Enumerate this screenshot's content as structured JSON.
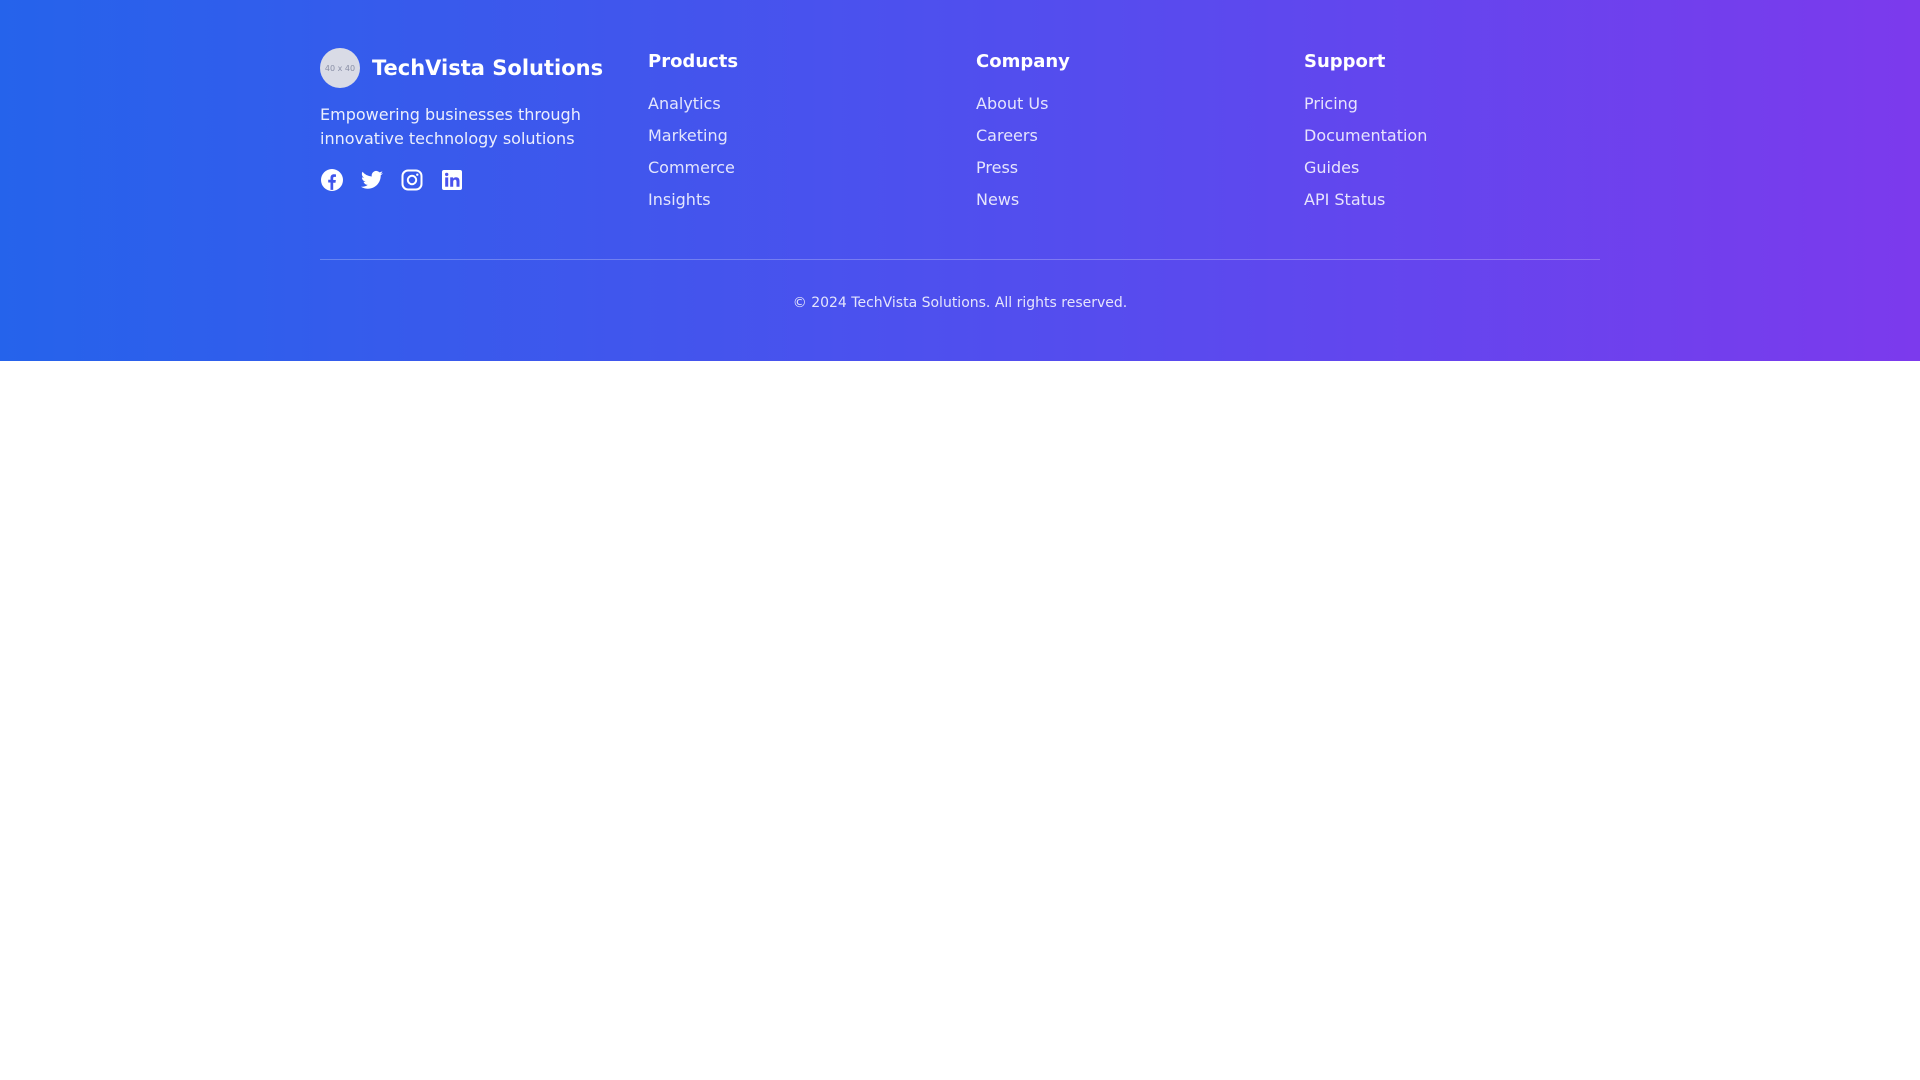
{
  "brand": {
    "logo_placeholder": "40 x 40",
    "name": "TechVista Solutions",
    "tagline": "Empowering businesses through innovative technology solutions",
    "socials": [
      {
        "icon": "facebook-icon"
      },
      {
        "icon": "twitter-icon"
      },
      {
        "icon": "instagram-icon"
      },
      {
        "icon": "linkedin-icon"
      }
    ]
  },
  "columns": {
    "products": {
      "title": "Products",
      "links": [
        "Analytics",
        "Marketing",
        "Commerce",
        "Insights"
      ]
    },
    "company": {
      "title": "Company",
      "links": [
        "About Us",
        "Careers",
        "Press",
        "News"
      ]
    },
    "support": {
      "title": "Support",
      "links": [
        "Pricing",
        "Documentation",
        "Guides",
        "API Status"
      ]
    }
  },
  "copyright": "© 2024 TechVista Solutions. All rights reserved.",
  "colors": {
    "gradient_start": "#2563eb",
    "gradient_end": "#7c3aed",
    "text": "#ffffff"
  }
}
